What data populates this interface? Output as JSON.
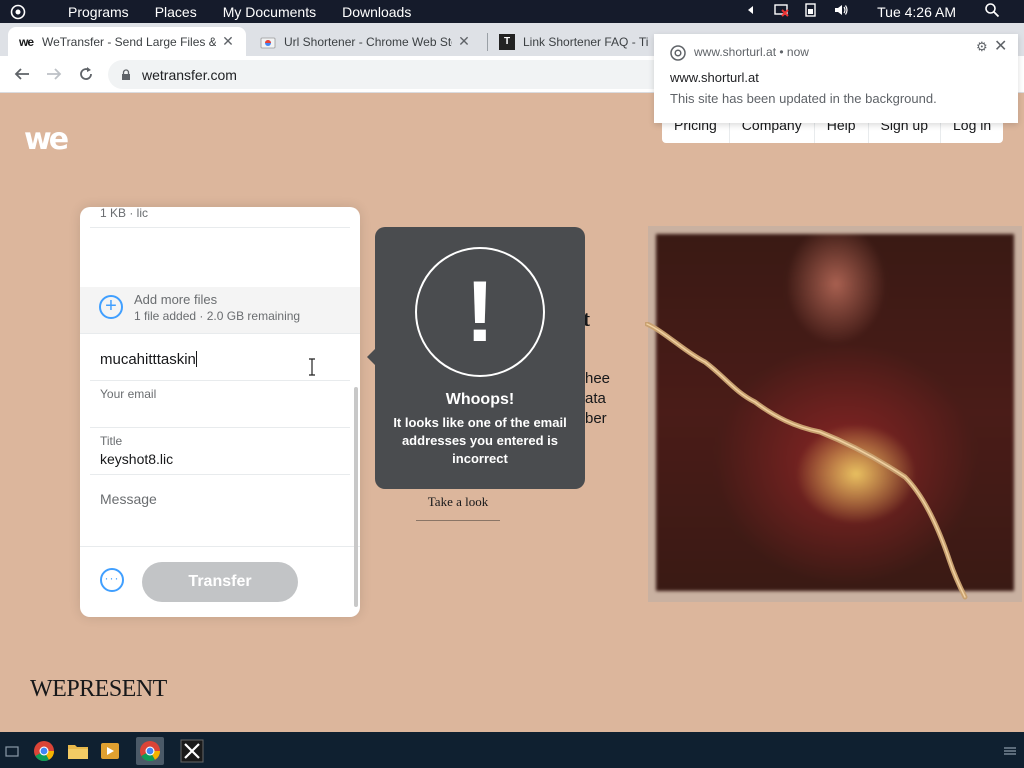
{
  "system_panel": {
    "menu": [
      "Programs",
      "Places",
      "My Documents",
      "Downloads"
    ],
    "clock": "Tue 4:26 AM"
  },
  "browser": {
    "tabs": [
      {
        "title": "WeTransfer - Send Large Files &",
        "active": true
      },
      {
        "title": "Url Shortener - Chrome Web Sto",
        "active": false
      },
      {
        "title": "Link Shortener FAQ - Tim",
        "active": false
      }
    ],
    "url": "wetransfer.com"
  },
  "notification": {
    "origin": "www.shorturl.at",
    "time": "now",
    "title": "www.shorturl.at",
    "body": "This site has been updated in the background."
  },
  "nav": {
    "items": [
      "Pricing",
      "Company",
      "Help",
      "Sign up",
      "Log in"
    ]
  },
  "upload": {
    "file_meta": "1 KB · lic",
    "add_files_title": "Add more files",
    "add_files_sub": "1 file added · 2.0 GB remaining",
    "email_to": "mucahitttaskin",
    "your_email_label": "Your email",
    "title_label": "Title",
    "title_value": "keyshot8.lic",
    "message_placeholder": "Message",
    "more_icon": "···",
    "transfer_label": "Transfer"
  },
  "error": {
    "symbol": "!",
    "title": "Whoops!",
    "message": "It looks like one of the email addresses you entered is incorrect"
  },
  "article": {
    "fragments": [
      "et",
      "hee",
      "ata",
      "ber"
    ],
    "link": "Take a look"
  },
  "footer": {
    "brand": "WEPRESENT"
  },
  "colors": {
    "page_bg": "#dcb69c",
    "accent": "#409fff",
    "tooltip_bg": "#4a4c4f",
    "button_disabled": "#c2c4c6"
  }
}
